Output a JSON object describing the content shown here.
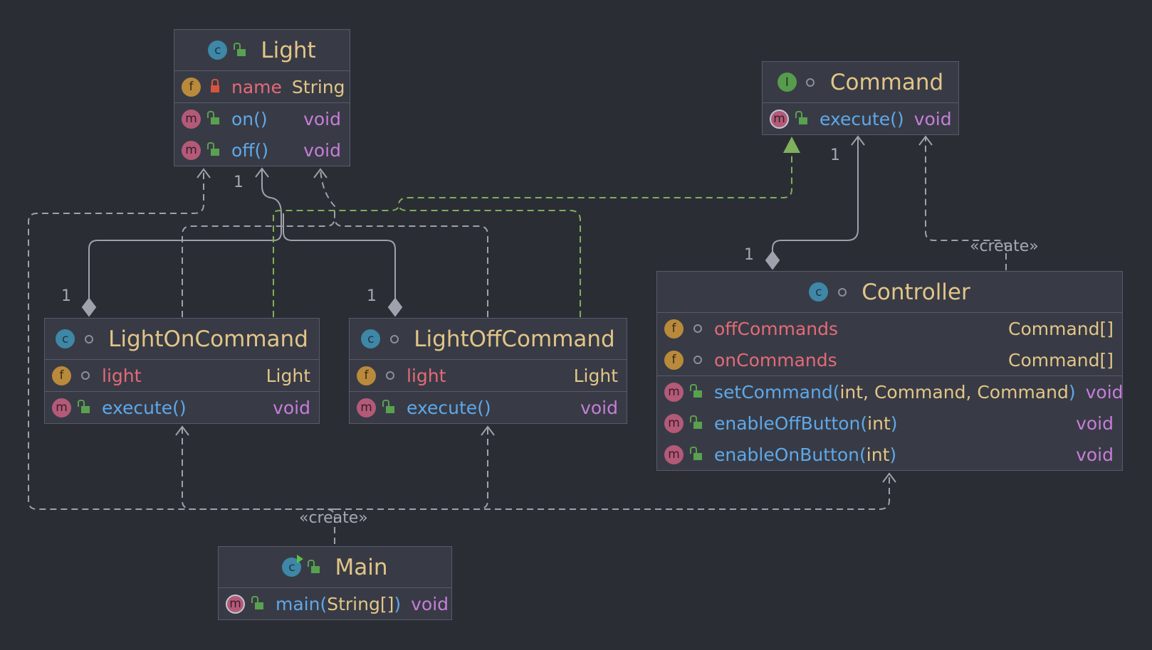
{
  "diagram": {
    "classes": {
      "light": {
        "name": "Light",
        "kind_icon": "class-icon",
        "fields": [
          {
            "icon": "field-icon",
            "visibility": "private-lock-icon",
            "name": "name",
            "type": "String"
          }
        ],
        "methods": [
          {
            "icon": "method-icon",
            "visibility": "public-unlock-icon",
            "name": "on",
            "params": "",
            "type": "void"
          },
          {
            "icon": "method-icon",
            "visibility": "public-unlock-icon",
            "name": "off",
            "params": "",
            "type": "void"
          }
        ]
      },
      "command": {
        "name": "Command",
        "kind_icon": "interface-icon",
        "fields": [],
        "methods": [
          {
            "icon": "abstract-method-icon",
            "visibility": "public-unlock-icon",
            "name": "execute",
            "params": "",
            "type": "void"
          }
        ]
      },
      "light_on_command": {
        "name": "LightOnCommand",
        "kind_icon": "class-icon",
        "fields": [
          {
            "icon": "field-icon",
            "visibility": "package-dot-icon",
            "name": "light",
            "type": "Light"
          }
        ],
        "methods": [
          {
            "icon": "method-icon",
            "visibility": "public-unlock-icon",
            "name": "execute",
            "params": "",
            "type": "void"
          }
        ]
      },
      "light_off_command": {
        "name": "LightOffCommand",
        "kind_icon": "class-icon",
        "fields": [
          {
            "icon": "field-icon",
            "visibility": "package-dot-icon",
            "name": "light",
            "type": "Light"
          }
        ],
        "methods": [
          {
            "icon": "method-icon",
            "visibility": "public-unlock-icon",
            "name": "execute",
            "params": "",
            "type": "void"
          }
        ]
      },
      "controller": {
        "name": "Controller",
        "kind_icon": "class-icon",
        "fields": [
          {
            "icon": "field-icon",
            "visibility": "package-dot-icon",
            "name": "offCommands",
            "type": "Command[]"
          },
          {
            "icon": "field-icon",
            "visibility": "package-dot-icon",
            "name": "onCommands",
            "type": "Command[]"
          }
        ],
        "methods": [
          {
            "icon": "method-icon",
            "visibility": "public-unlock-icon",
            "name": "setCommand",
            "params": "int, Command, Command",
            "type": "void"
          },
          {
            "icon": "method-icon",
            "visibility": "public-unlock-icon",
            "name": "enableOffButton",
            "params": "int",
            "type": "void"
          },
          {
            "icon": "method-icon",
            "visibility": "public-unlock-icon",
            "name": "enableOnButton",
            "params": "int",
            "type": "void"
          }
        ]
      },
      "main": {
        "name": "Main",
        "kind_icon": "runnable-class-icon",
        "fields": [],
        "methods": [
          {
            "icon": "static-method-icon",
            "visibility": "public-unlock-icon",
            "name": "main",
            "params": "String[]",
            "type": "void"
          }
        ]
      }
    },
    "multiplicities": {
      "light_from_on": "1",
      "light_from_off": "1",
      "on_side": "1",
      "off_side": "1",
      "command_end": "1",
      "controller_side": "1"
    },
    "stereotypes": {
      "controller_create": "«create»",
      "main_create": "«create»"
    },
    "colors": {
      "background": "#2b2d34",
      "node_fill": "#383b45",
      "node_border": "#585c68",
      "class_name": "#e2c588",
      "field_name": "#e46a78",
      "method_name": "#5ea8ea",
      "void_type": "#c77dda",
      "edge": "#9ea2ac",
      "realization_edge": "#7fb05c"
    }
  }
}
